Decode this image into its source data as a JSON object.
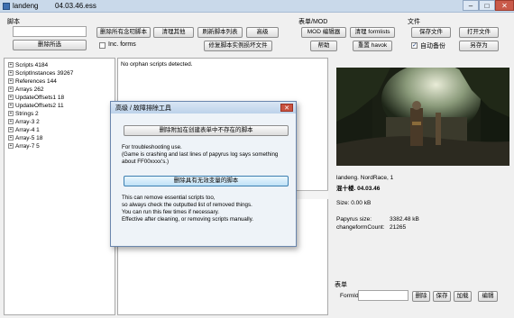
{
  "window": {
    "app_name": "landeng",
    "file_name": "04.03.46.ess",
    "min_icon": "minimize-icon",
    "max_icon": "maximize-icon",
    "close_icon": "close-icon",
    "min_glyph": "–",
    "max_glyph": "□",
    "close_glyph": "✕"
  },
  "scripts": {
    "section_label": "脚本",
    "delete_selected": "删除所选",
    "inc_forms": "Inc. forms",
    "delete_unattached": "删除所有念叨脚本",
    "clean_other": "清理其他",
    "refresh_list": "刷新脚本列表",
    "advanced": "高级",
    "fix_script_instances": "修复脚本实例损坏文件"
  },
  "forms": {
    "section_label": "表单/MOD",
    "mod_editor": "MOD 编辑器",
    "clean_formlists": "清理 formlists",
    "help": "帮助",
    "reset_havok": "重置 havok"
  },
  "file": {
    "section_label": "文件",
    "save_file": "保存文件",
    "open_file": "打开文件",
    "auto_backup": "自动备份",
    "auto_backup_checked": true,
    "save_as": "另存为"
  },
  "tree": [
    {
      "label": "Scripts 4184"
    },
    {
      "label": "ScriptInstances 39267"
    },
    {
      "label": "References 144"
    },
    {
      "label": "Arrays 262"
    },
    {
      "label": "UpdateOffsets1 18"
    },
    {
      "label": "UpdateOffsets2 11"
    },
    {
      "label": "Strings 2"
    },
    {
      "label": "Array-3 2"
    },
    {
      "label": "Array-4 1"
    },
    {
      "label": "Array-5 18"
    },
    {
      "label": "Array-7 5"
    }
  ],
  "output": {
    "message": "No orphan scripts detected."
  },
  "save_info": {
    "name_line": "landeng. NordRace, 1",
    "location_line": "混十楼. 04.03.46",
    "size_line": "Size: 0.00 kB",
    "papyrus_label": "Papyrus size:",
    "papyrus_value": "3382.48 kB",
    "change_label": "changeformCount:",
    "change_value": "21265"
  },
  "form_panel": {
    "section_label": "表单",
    "formid_label": "FormId",
    "formid_value": "",
    "delete": "删除",
    "save": "保存",
    "load": "加载",
    "edit": "编辑"
  },
  "dialog": {
    "title": "高级 / 故障排除工具",
    "close_glyph": "✕",
    "btn_remove_missing": "删除附加在创建表单中不存在的脚本",
    "ts_line1": "For troubleshooting use.",
    "ts_line2": "(Game is crashing and last lines of papyrus log says something",
    "ts_line3": "about FF00xxxx's.)",
    "btn_remove_invalid": "删除具有无效变量的脚本",
    "warn_line1": "This can remove essential scripts too,",
    "warn_line2": "so always check the outputted list of removed things.",
    "warn_line3": "You can run this few times if necessary.",
    "warn_line4": "Effective after cleaning, or removing scripts manually."
  }
}
